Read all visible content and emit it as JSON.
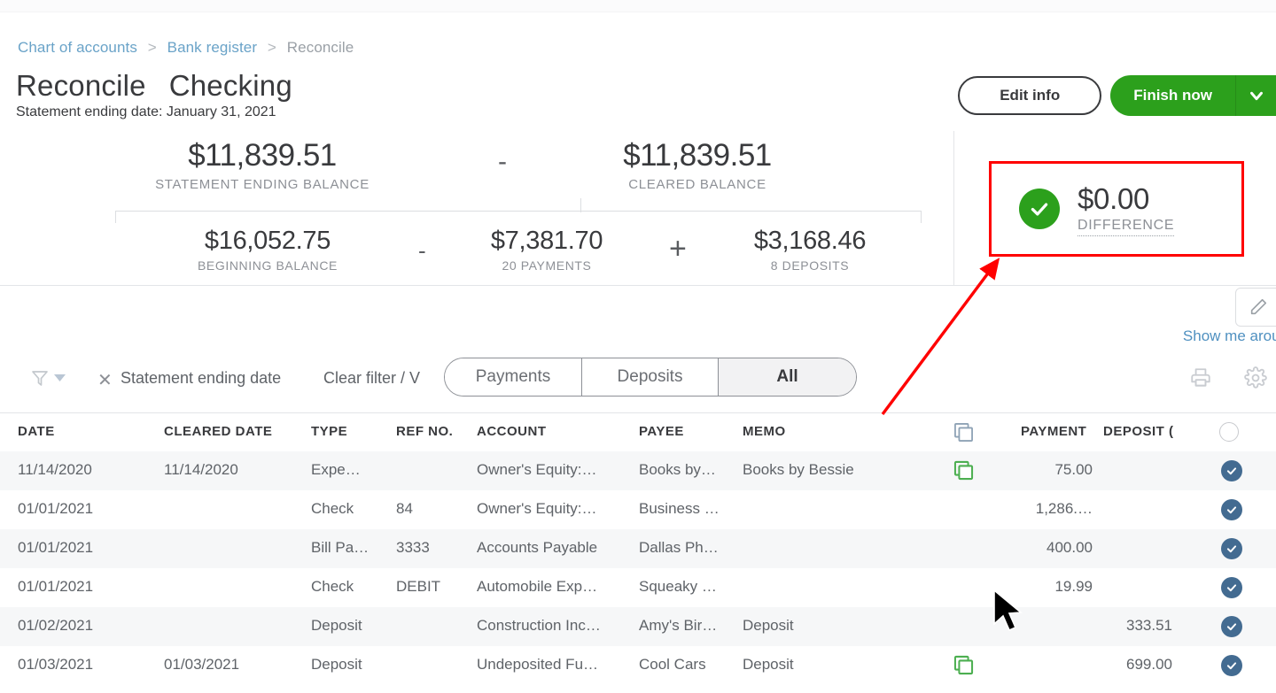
{
  "breadcrumb": {
    "items": [
      {
        "label": "Chart of accounts",
        "type": "link"
      },
      {
        "label": "Bank register",
        "type": "link"
      },
      {
        "label": "Reconcile",
        "type": "current"
      }
    ],
    "separator": ">"
  },
  "header": {
    "title": "Reconcile",
    "account": "Checking",
    "subtitle": "Statement ending date: January 31, 2021",
    "edit_info_label": "Edit info",
    "finish_now_label": "Finish now",
    "caret_icon": "chevron-down-icon"
  },
  "summary": {
    "statement_ending": {
      "amount": "$11,839.51",
      "label": "STATEMENT ENDING BALANCE"
    },
    "operator_top": "-",
    "cleared": {
      "amount": "$11,839.51",
      "label": "CLEARED BALANCE"
    },
    "beginning": {
      "amount": "$16,052.75",
      "label": "BEGINNING BALANCE"
    },
    "operator_minus": "-",
    "payments": {
      "amount": "$7,381.70",
      "label": "20 PAYMENTS"
    },
    "operator_plus": "+",
    "deposits": {
      "amount": "$3,168.46",
      "label": "8 DEPOSITS"
    },
    "difference": {
      "amount": "$0.00",
      "label": "DIFFERENCE",
      "status_icon": "check-circle-icon",
      "status_color": "#2ca01c"
    }
  },
  "annotations": {
    "highlight_color": "#ff0000",
    "arrow_color": "#ff0000"
  },
  "help": {
    "show_me_around": "Show me aroun"
  },
  "filters": {
    "funnel_icon": "filter-funnel-icon",
    "clear_icon": "close-icon",
    "chip_label": "Statement ending date",
    "clear_filter_label": "Clear filter / V",
    "tabs": [
      {
        "label": "Payments",
        "active": false
      },
      {
        "label": "Deposits",
        "active": false
      },
      {
        "label": "All",
        "active": true
      }
    ],
    "print_icon": "printer-icon",
    "settings_icon": "gear-icon"
  },
  "table": {
    "columns": [
      "DATE",
      "CLEARED DATE",
      "TYPE",
      "REF NO.",
      "ACCOUNT",
      "PAYEE",
      "MEMO",
      "PAYMENT",
      "DEPOSIT ("
    ],
    "attachment_header_icon": "attachment-copy-icon",
    "select_all_icon": "circle-empty-icon",
    "rows": [
      {
        "date": "11/14/2020",
        "cleared_date": "11/14/2020",
        "type": "Expe…",
        "ref_no": "",
        "account": "Owner's Equity:…",
        "payee": "Books by…",
        "memo": "Books by Bessie",
        "attachment": true,
        "payment": "75.00",
        "deposit": "",
        "cleared": true
      },
      {
        "date": "01/01/2021",
        "cleared_date": "",
        "type": "Check",
        "ref_no": "84",
        "account": "Owner's Equity:…",
        "payee": "Business …",
        "memo": "",
        "attachment": false,
        "payment": "1,286.…",
        "deposit": "",
        "cleared": true
      },
      {
        "date": "01/01/2021",
        "cleared_date": "",
        "type": "Bill Pa…",
        "ref_no": "3333",
        "account": "Accounts Payable",
        "payee": "Dallas Ph…",
        "memo": "",
        "attachment": false,
        "payment": "400.00",
        "deposit": "",
        "cleared": true
      },
      {
        "date": "01/01/2021",
        "cleared_date": "",
        "type": "Check",
        "ref_no": "DEBIT",
        "account": "Automobile Exp…",
        "payee": "Squeaky …",
        "memo": "",
        "attachment": false,
        "payment": "19.99",
        "deposit": "",
        "cleared": true
      },
      {
        "date": "01/02/2021",
        "cleared_date": "",
        "type": "Deposit",
        "ref_no": "",
        "account": "Construction Inc…",
        "payee": "Amy's Bir…",
        "memo": "Deposit",
        "attachment": false,
        "payment": "",
        "deposit": "333.51",
        "cleared": true
      },
      {
        "date": "01/03/2021",
        "cleared_date": "01/03/2021",
        "type": "Deposit",
        "ref_no": "",
        "account": "Undeposited Fu…",
        "payee": "Cool Cars",
        "memo": "Deposit",
        "attachment": true,
        "payment": "",
        "deposit": "699.00",
        "cleared": true
      }
    ]
  }
}
